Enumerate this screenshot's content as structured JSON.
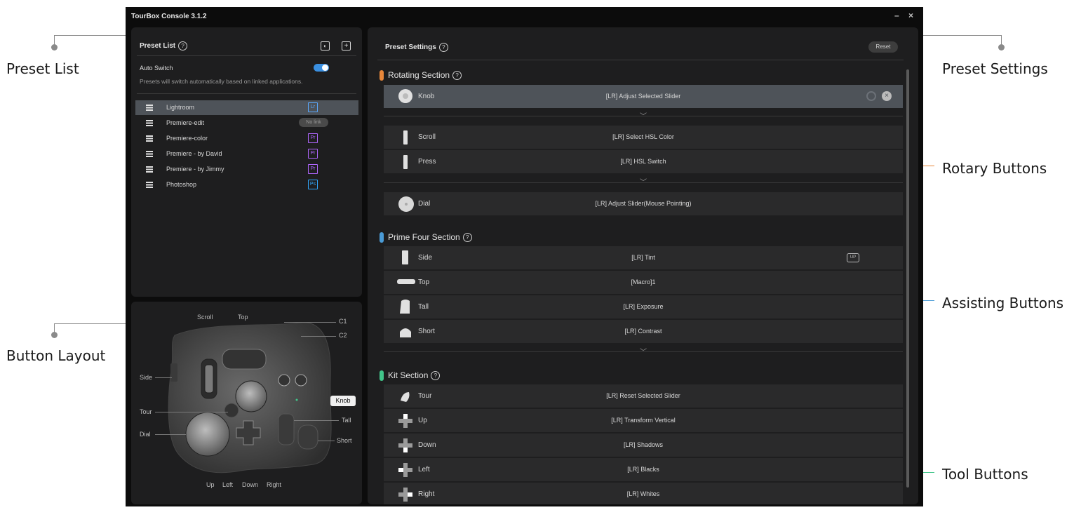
{
  "window": {
    "title": "TourBox Console 3.1.2",
    "minimize": "–",
    "close": "×"
  },
  "callouts": {
    "preset_list": "Preset List",
    "button_layout": "Button Layout",
    "preset_settings": "Preset Settings",
    "rotary_buttons": "Rotary Buttons",
    "assisting_buttons": "Assisting Buttons",
    "tool_buttons": "Tool Buttons",
    "colors": {
      "rotary": "#e8873a",
      "assisting": "#4a9bd6",
      "tool": "#41c58a"
    }
  },
  "preset_list": {
    "title": "Preset List",
    "help": "?",
    "auto_switch_label": "Auto Switch",
    "auto_switch_on": true,
    "auto_switch_desc": "Presets will switch automatically based on linked applications.",
    "presets": [
      {
        "name": "Lightroom",
        "app": "Lr",
        "app_color": "#5aa9ff",
        "selected": true
      },
      {
        "name": "Premiere-edit",
        "nolink": "No link"
      },
      {
        "name": "Premiere-color",
        "app": "Pr",
        "app_color": "#b066ff"
      },
      {
        "name": "Premiere - by David",
        "app": "Pr",
        "app_color": "#b066ff"
      },
      {
        "name": "Premiere - by Jimmy",
        "app": "Pr",
        "app_color": "#b066ff"
      },
      {
        "name": "Photoshop",
        "app": "Ps",
        "app_color": "#31a8ff"
      }
    ]
  },
  "button_layout": {
    "labels": {
      "scroll": "Scroll",
      "top": "Top",
      "c1": "C1",
      "c2": "C2",
      "side": "Side",
      "knob": "Knob",
      "tour": "Tour",
      "dial": "Dial",
      "tall": "Tall",
      "short": "Short",
      "up": "Up",
      "left": "Left",
      "down": "Down",
      "right": "Right"
    }
  },
  "preset_settings": {
    "title": "Preset Settings",
    "help": "?",
    "reset": "Reset",
    "sections": {
      "rotating": "Rotating Section",
      "prime_four": "Prime Four Section",
      "kit": "Kit Section"
    },
    "rows": [
      {
        "label": "Knob",
        "fn": "[LR] Adjust Selected Slider"
      },
      {
        "label": "Scroll",
        "fn": "[LR] Select HSL Color"
      },
      {
        "label": "Press",
        "fn": "[LR] HSL Switch"
      },
      {
        "label": "Dial",
        "fn": "[LR] Adjust Slider(Mouse Pointing)"
      },
      {
        "label": "Side",
        "fn": "[LR] Tint",
        "badge": "UP"
      },
      {
        "label": "Top",
        "fn": "[Macro]1"
      },
      {
        "label": "Tall",
        "fn": "[LR] Exposure"
      },
      {
        "label": "Short",
        "fn": "[LR] Contrast"
      },
      {
        "label": "Tour",
        "fn": "[LR] Reset Selected Slider"
      },
      {
        "label": "Up",
        "fn": "[LR] Transform Vertical"
      },
      {
        "label": "Down",
        "fn": "[LR] Shadows"
      },
      {
        "label": "Left",
        "fn": "[LR] Blacks"
      },
      {
        "label": "Right",
        "fn": "[LR] Whites"
      }
    ]
  }
}
